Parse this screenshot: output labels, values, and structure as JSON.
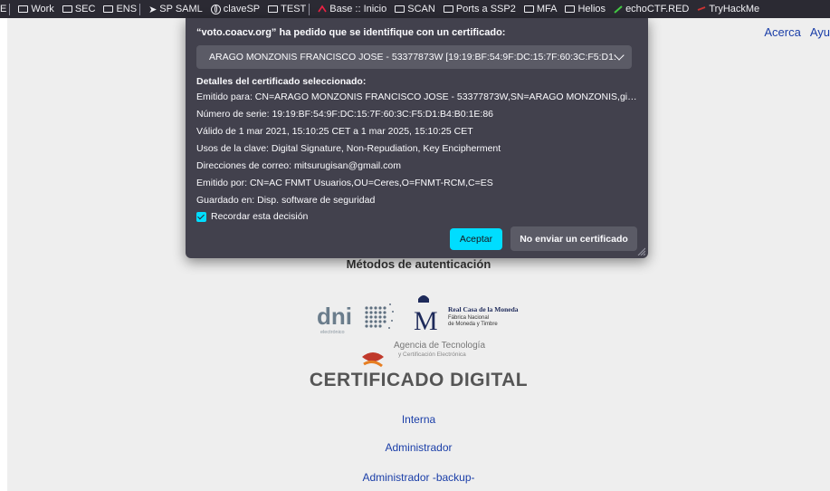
{
  "bookmarks": {
    "items": [
      {
        "label": "E"
      },
      {
        "label": "Work"
      },
      {
        "label": "SEC"
      },
      {
        "label": "ENS"
      },
      {
        "label": "SP SAML"
      },
      {
        "label": "claveSP"
      },
      {
        "label": "TEST"
      },
      {
        "label": "Base :: Inicio"
      },
      {
        "label": "SCAN"
      },
      {
        "label": "Ports a SSP2"
      },
      {
        "label": "MFA"
      },
      {
        "label": "Helios"
      },
      {
        "label": "echoCTF.RED"
      },
      {
        "label": "TryHackMe"
      }
    ]
  },
  "page": {
    "nav": {
      "about": "Acerca",
      "help": "Ayu"
    },
    "auth_methods_title": "Métodos de autenticación",
    "logos": {
      "dni_text": "dni",
      "dni_sub": "electrónico",
      "fnmt_title": "Real Casa de la Moneda",
      "fnmt_sub1": "Fábrica Nacional",
      "fnmt_sub2": "de Moneda y Timbre",
      "agency_title": "Agencia de Tecnología",
      "agency_sub": "y Certificación Electrónica"
    },
    "cert_title": "CERTIFICADO DIGITAL",
    "links": {
      "internal": "Interna",
      "admin": "Administrador",
      "admin_backup": "Administrador -backup-"
    }
  },
  "dialog": {
    "title": "“voto.coacv.org” ha pedido que se identifique con un certificado:",
    "selected_certificate": "ARAGO MONZONIS FRANCISCO JOSE - 53377873W [19:19:BF:54:9F:DC:15:7F:60:3C:F5:D1:B...",
    "details_header": "Detalles del certificado seleccionado:",
    "details": {
      "issued_to": "Emitido para: CN=ARAGO MONZONIS FRANCISCO JOSE - 53377873W,SN=ARAGO MONZONIS,given...",
      "serial": "Número de serie: 19:19:BF:54:9F:DC:15:7F:60:3C:F5:D1:B4:B0:1E:86",
      "validity": "Válido de 1 mar 2021, 15:10:25 CET a 1 mar 2025, 15:10:25 CET",
      "key_usage": "Usos de la clave: Digital Signature, Non-Repudiation, Key Encipherment",
      "emails": "Direcciones de correo: mitsurugisan@gmail.com",
      "issued_by": "Emitido por: CN=AC FNMT Usuarios,OU=Ceres,O=FNMT-RCM,C=ES",
      "stored_in": "Guardado en: Disp. software de seguridad"
    },
    "remember_label": "Recordar esta decisión",
    "remember_checked": true,
    "accept_label": "Aceptar",
    "deny_label": "No enviar un certificado"
  },
  "colors": {
    "dialog_bg": "#42414d",
    "accent": "#00ddff",
    "link": "#1a3ea8",
    "page_bg": "#eeeeee"
  }
}
